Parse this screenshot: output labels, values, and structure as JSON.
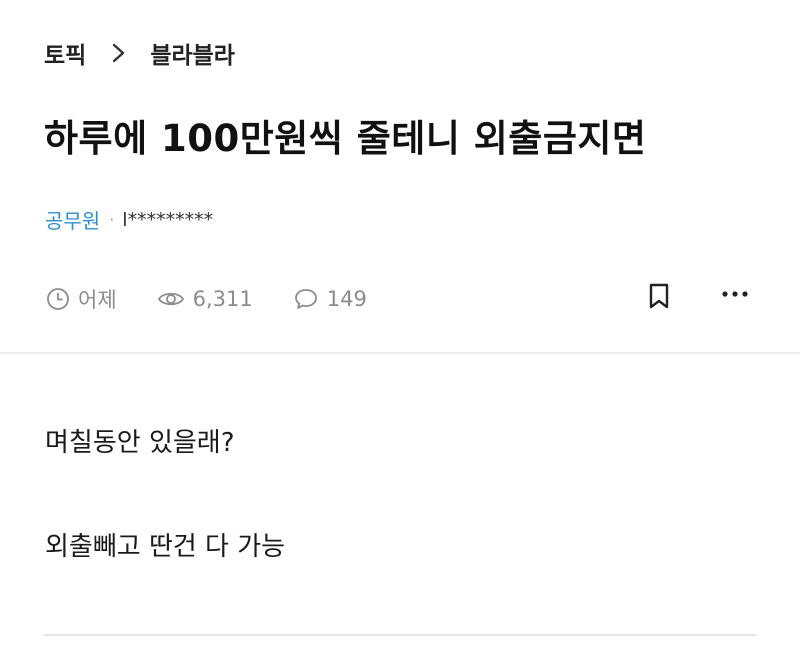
{
  "breadcrumb": {
    "parent": "토픽",
    "current": "블라블라"
  },
  "post": {
    "title": "하루에 100만원씩 줄테니 외출금지면",
    "author": {
      "company": "공무원",
      "separator": "·",
      "name": "l*********"
    },
    "meta": {
      "time": "어제",
      "views": "6,311",
      "comments": "149"
    },
    "body": [
      "며칠동안 있을래?",
      "외출빼고 딴건 다 가능"
    ]
  },
  "icons": {
    "breadcrumb_separator": "chevron-right-icon",
    "time": "clock-icon",
    "views": "eye-icon",
    "comments": "comment-icon",
    "bookmark": "bookmark-icon",
    "more": "more-horizontal-icon"
  },
  "colors": {
    "company": "#2c8fc9",
    "meta_text": "#8c8c8c"
  }
}
